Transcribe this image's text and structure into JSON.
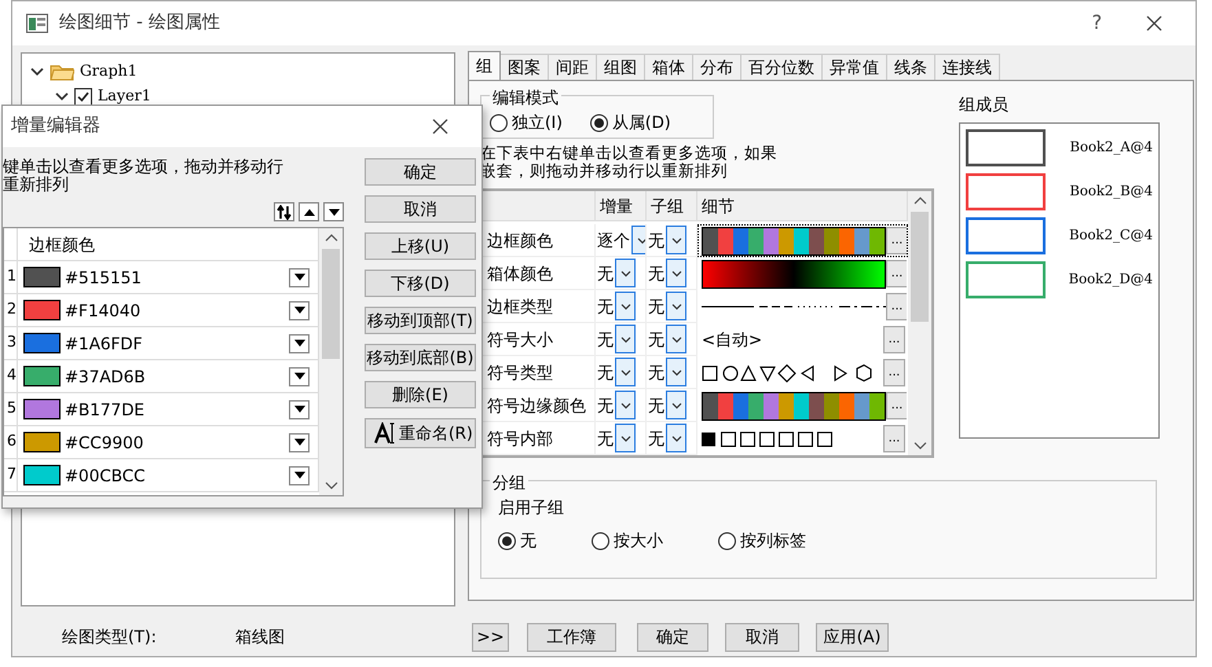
{
  "main_window": {
    "title": "绘图细节 - 绘图属性",
    "help": "?"
  },
  "tree": [
    {
      "label": "Graph1",
      "expanded": true,
      "children": [
        {
          "label": "Layer1",
          "expanded": true,
          "checked": true
        }
      ]
    }
  ],
  "tabs": [
    {
      "label": "组",
      "selected": true
    },
    {
      "label": "图案",
      "selected": false
    },
    {
      "label": "间距",
      "selected": false
    },
    {
      "label": "组图",
      "selected": false
    },
    {
      "label": "箱体",
      "selected": false
    },
    {
      "label": "分布",
      "selected": false
    },
    {
      "label": "百分位数",
      "selected": false
    },
    {
      "label": "异常值",
      "selected": false
    },
    {
      "label": "线条",
      "selected": false
    },
    {
      "label": "连接线",
      "selected": false
    }
  ],
  "edit_mode": {
    "title": "编辑模式",
    "options": [
      {
        "label": "独立(I)",
        "selected": false
      },
      {
        "label": "从属(D)",
        "selected": true
      }
    ]
  },
  "instructions": "在下表中右键单击以查看更多选项，如果嵌套，则拖动并移动行以重新排列",
  "increment_table": {
    "columns": [
      "增量",
      "子组",
      "细节"
    ],
    "rows": [
      {
        "label": "边框颜色",
        "increment": "逐个",
        "subgroup": "无",
        "selected": true,
        "more": "...",
        "detail": {
          "kind": "palette"
        }
      },
      {
        "label": "箱体颜色",
        "increment": "无",
        "subgroup": "无",
        "selected": false,
        "more": "...",
        "detail": {
          "kind": "gradient"
        }
      },
      {
        "label": "边框类型",
        "increment": "无",
        "subgroup": "无",
        "selected": false,
        "more": "...",
        "detail": {
          "kind": "line_styles"
        }
      },
      {
        "label": "符号大小",
        "increment": "无",
        "subgroup": "无",
        "selected": false,
        "more": "...",
        "detail": {
          "kind": "text",
          "text": "<自动>"
        }
      },
      {
        "label": "符号类型",
        "increment": "无",
        "subgroup": "无",
        "selected": false,
        "more": "...",
        "detail": {
          "kind": "symbols"
        }
      },
      {
        "label": "符号边缘颜色",
        "increment": "无",
        "subgroup": "无",
        "selected": false,
        "more": "...",
        "detail": {
          "kind": "palette"
        }
      },
      {
        "label": "符号内部",
        "increment": "无",
        "subgroup": "无",
        "selected": false,
        "more": "...",
        "detail": {
          "kind": "patterns"
        }
      }
    ]
  },
  "members": {
    "title": "组成员",
    "items": [
      {
        "label": "Book2_A@4",
        "color": "#515151"
      },
      {
        "label": "Book2_B@4",
        "color": "#f14040"
      },
      {
        "label": "Book2_C@4",
        "color": "#1a6fdf"
      },
      {
        "label": "Book2_D@4",
        "color": "#37ad6b"
      }
    ]
  },
  "grouping": {
    "title": "分组",
    "subtitle": "启用子组",
    "options": [
      {
        "label": "无",
        "selected": true
      },
      {
        "label": "按大小",
        "selected": false
      },
      {
        "label": "按列标签",
        "selected": false
      }
    ]
  },
  "footer": {
    "plot_type_label": "绘图类型(T):",
    "plot_type": "箱线图",
    "buttons": [
      ">>",
      "工作簿",
      "确定",
      "取消",
      "应用(A)"
    ]
  },
  "increment_editor": {
    "title": "增量编辑器",
    "instructions": [
      "键单击以查看更多选项，拖动并移动行",
      "重新排列"
    ],
    "column": "边框颜色",
    "rows": [
      {
        "number": "1",
        "color": "#515151",
        "value": "#515151"
      },
      {
        "number": "2",
        "color": "#f14040",
        "value": "#F14040"
      },
      {
        "number": "3",
        "color": "#1a6fdf",
        "value": "#1A6FDF"
      },
      {
        "number": "4",
        "color": "#37ad6b",
        "value": "#37AD6B"
      },
      {
        "number": "5",
        "color": "#b177de",
        "value": "#B177DE"
      },
      {
        "number": "6",
        "color": "#cc9900",
        "value": "#CC9900"
      },
      {
        "number": "7",
        "color": "#00cbcc",
        "value": "#00CBCC"
      }
    ],
    "buttons": [
      {
        "label": "确定",
        "kind": "plain"
      },
      {
        "label": "取消",
        "kind": "plain"
      },
      {
        "label": "上移(U)",
        "kind": "plain"
      },
      {
        "label": "下移(D)",
        "kind": "plain"
      },
      {
        "label": "移动到顶部(T)",
        "kind": "plain"
      },
      {
        "label": "移动到底部(B)",
        "kind": "plain"
      },
      {
        "label": "删除(E)",
        "kind": "plain"
      },
      {
        "label": "重命名(R)",
        "kind": "rename"
      }
    ]
  }
}
